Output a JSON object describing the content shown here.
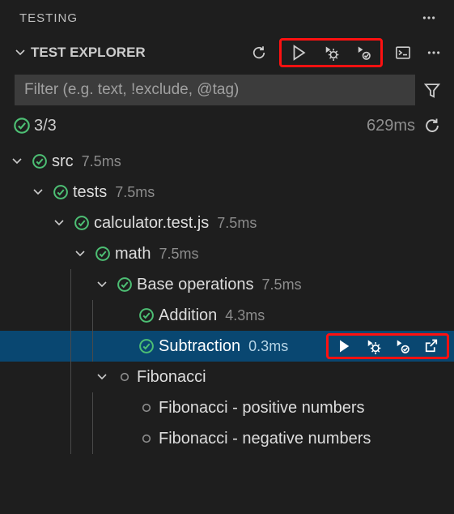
{
  "panel": {
    "title": "TESTING"
  },
  "section": {
    "title": "TEST EXPLORER"
  },
  "filter": {
    "placeholder": "Filter (e.g. text, !exclude, @tag)"
  },
  "summary": {
    "count": "3/3",
    "elapsed": "629ms"
  },
  "tree": {
    "src": {
      "label": "src",
      "time": "7.5ms"
    },
    "tests": {
      "label": "tests",
      "time": "7.5ms"
    },
    "calc": {
      "label": "calculator.test.js",
      "time": "7.5ms"
    },
    "math": {
      "label": "math",
      "time": "7.5ms"
    },
    "baseops": {
      "label": "Base operations",
      "time": "7.5ms"
    },
    "addition": {
      "label": "Addition",
      "time": "4.3ms"
    },
    "subtraction": {
      "label": "Subtraction",
      "time": "0.3ms"
    },
    "fib": {
      "label": "Fibonacci"
    },
    "fibpos": {
      "label": "Fibonacci - positive numbers"
    },
    "fibneg": {
      "label": "Fibonacci - negative numbers"
    }
  }
}
